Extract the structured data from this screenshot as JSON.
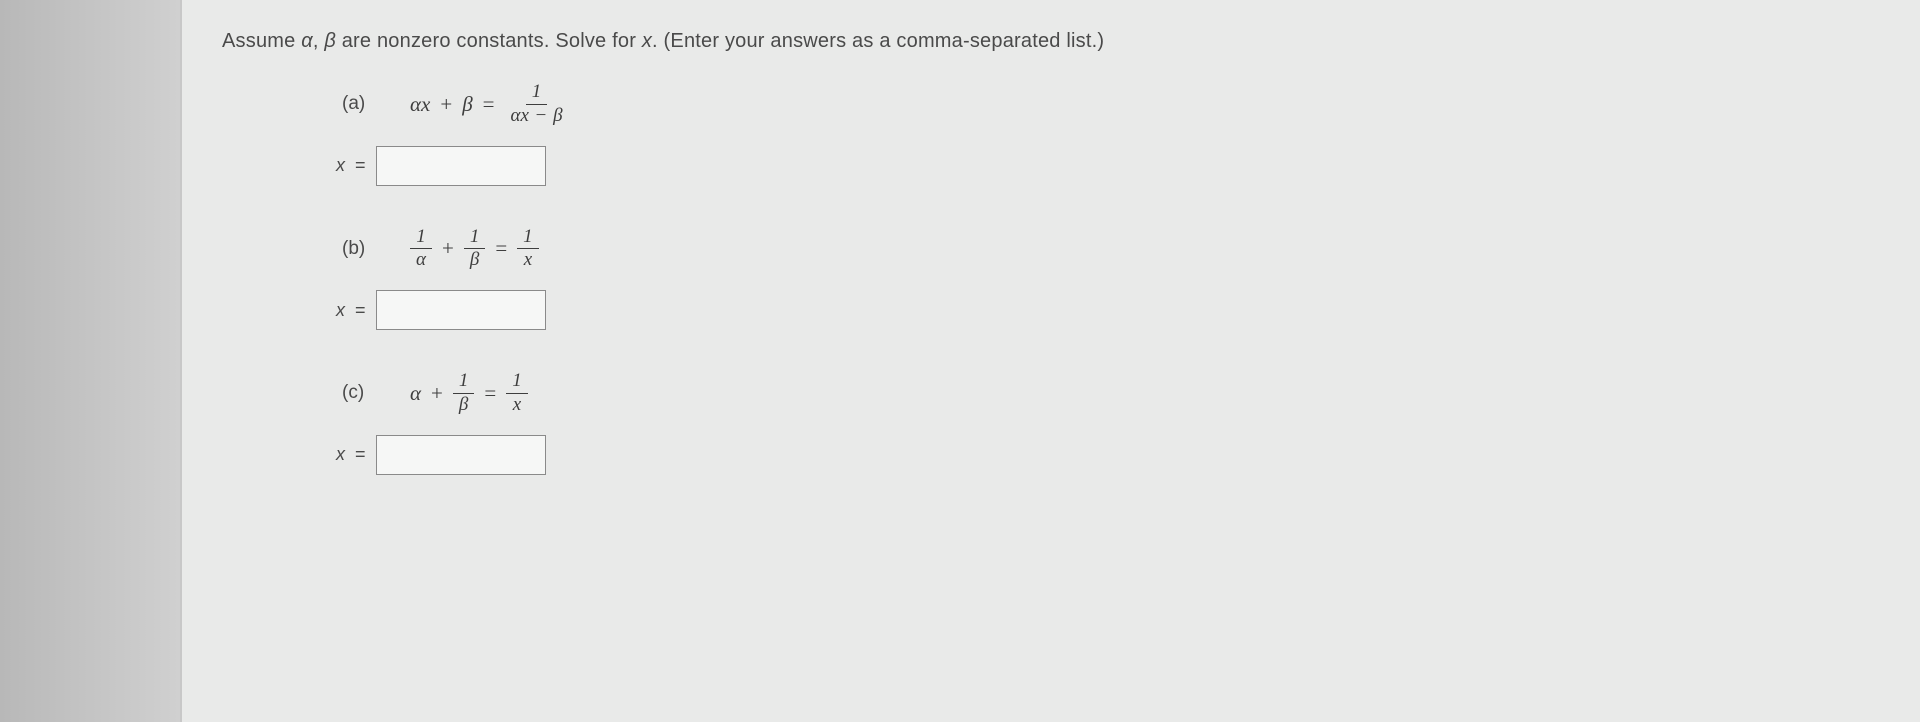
{
  "prompt": {
    "pre": "Assume ",
    "v1": "α",
    "mid1": ", ",
    "v2": "β",
    "mid2": " are nonzero constants. Solve for ",
    "v3": "x",
    "post": ". (Enter your answers as a comma-separated list.)"
  },
  "answer": {
    "var": "x",
    "eq": "="
  },
  "parts": {
    "a": {
      "label": "(a)",
      "eq": {
        "lhs": {
          "t1": "αx",
          "op": "+",
          "t2": "β"
        },
        "eqs": "=",
        "rhs": {
          "num": "1",
          "den_t1": "αx",
          "den_op": "−",
          "den_t2": "β"
        }
      },
      "value": ""
    },
    "b": {
      "label": "(b)",
      "eq": {
        "f1": {
          "num": "1",
          "den": "α"
        },
        "op1": "+",
        "f2": {
          "num": "1",
          "den": "β"
        },
        "eqs": "=",
        "f3": {
          "num": "1",
          "den": "x"
        }
      },
      "value": ""
    },
    "c": {
      "label": "(c)",
      "eq": {
        "t1": "α",
        "op1": "+",
        "f1": {
          "num": "1",
          "den": "β"
        },
        "eqs": "=",
        "f2": {
          "num": "1",
          "den": "x"
        }
      },
      "value": ""
    }
  }
}
